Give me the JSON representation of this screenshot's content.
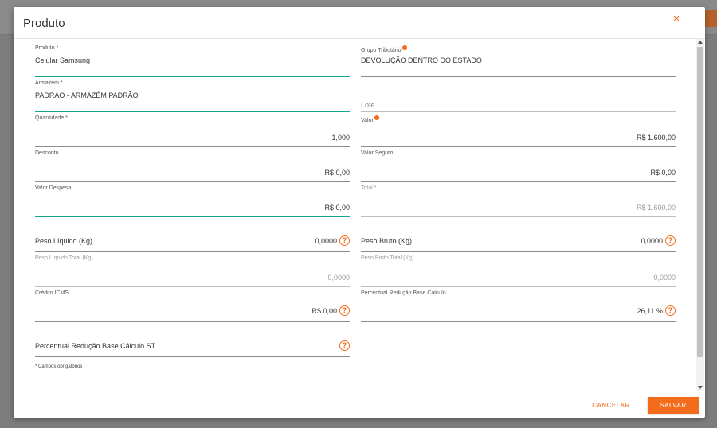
{
  "modal": {
    "title": "Produto",
    "close_icon": "×"
  },
  "fields": {
    "produto": {
      "label": "Produto *",
      "value": "Celular Samsung"
    },
    "grupo_tributario": {
      "label": "Grupo Tributário",
      "value": "DEVOLUÇÃO DENTRO DO ESTADO"
    },
    "armazem": {
      "label": "Armazém *",
      "value": "PADRAO - ARMAZÉM PADRÃO"
    },
    "lote": {
      "placeholder": "Lote"
    },
    "quantidade": {
      "label": "Quantidade *",
      "value": "1,000"
    },
    "valor": {
      "label": "Valor",
      "value": "R$ 1.600,00"
    },
    "desconto": {
      "label": "Desconto",
      "value": "R$ 0,00"
    },
    "valor_seguro": {
      "label": "Valor Seguro",
      "value": "R$ 0,00"
    },
    "valor_despesa": {
      "label": "Valor Despesa",
      "value": "R$ 0,00"
    },
    "total": {
      "label": "Total *",
      "value": "R$ 1.600,00"
    },
    "peso_liquido": {
      "label": "Peso Líquido (Kg)",
      "value": "0,0000"
    },
    "peso_bruto": {
      "label": "Peso Bruto (Kg)",
      "value": "0,0000"
    },
    "peso_liquido_total": {
      "label": "Peso Líquido Total (Kg)",
      "value": "0,0000"
    },
    "peso_bruto_total": {
      "label": "Peso Bruto Total (Kg)",
      "value": "0,0000"
    },
    "credito_icms": {
      "label": "Crédito ICMS",
      "value": "R$ 0,00"
    },
    "percentual_reducao_bc": {
      "label": "Percentual Redução Base Cálculo",
      "value": "26,11 %"
    },
    "percentual_reducao_bc_st": {
      "label": "Percentual Redução Base Cálculo ST."
    }
  },
  "help_icon_glyph": "?",
  "icons": {
    "help": "help-circle-icon",
    "info": "info-dot-icon",
    "close": "close-icon"
  },
  "required_note": "* Campos obrigatórios",
  "footer": {
    "cancel_label": "CANCELAR",
    "save_label": "SALVAR"
  },
  "colors": {
    "accent": "#f26c1c",
    "focus": "#17a589"
  }
}
